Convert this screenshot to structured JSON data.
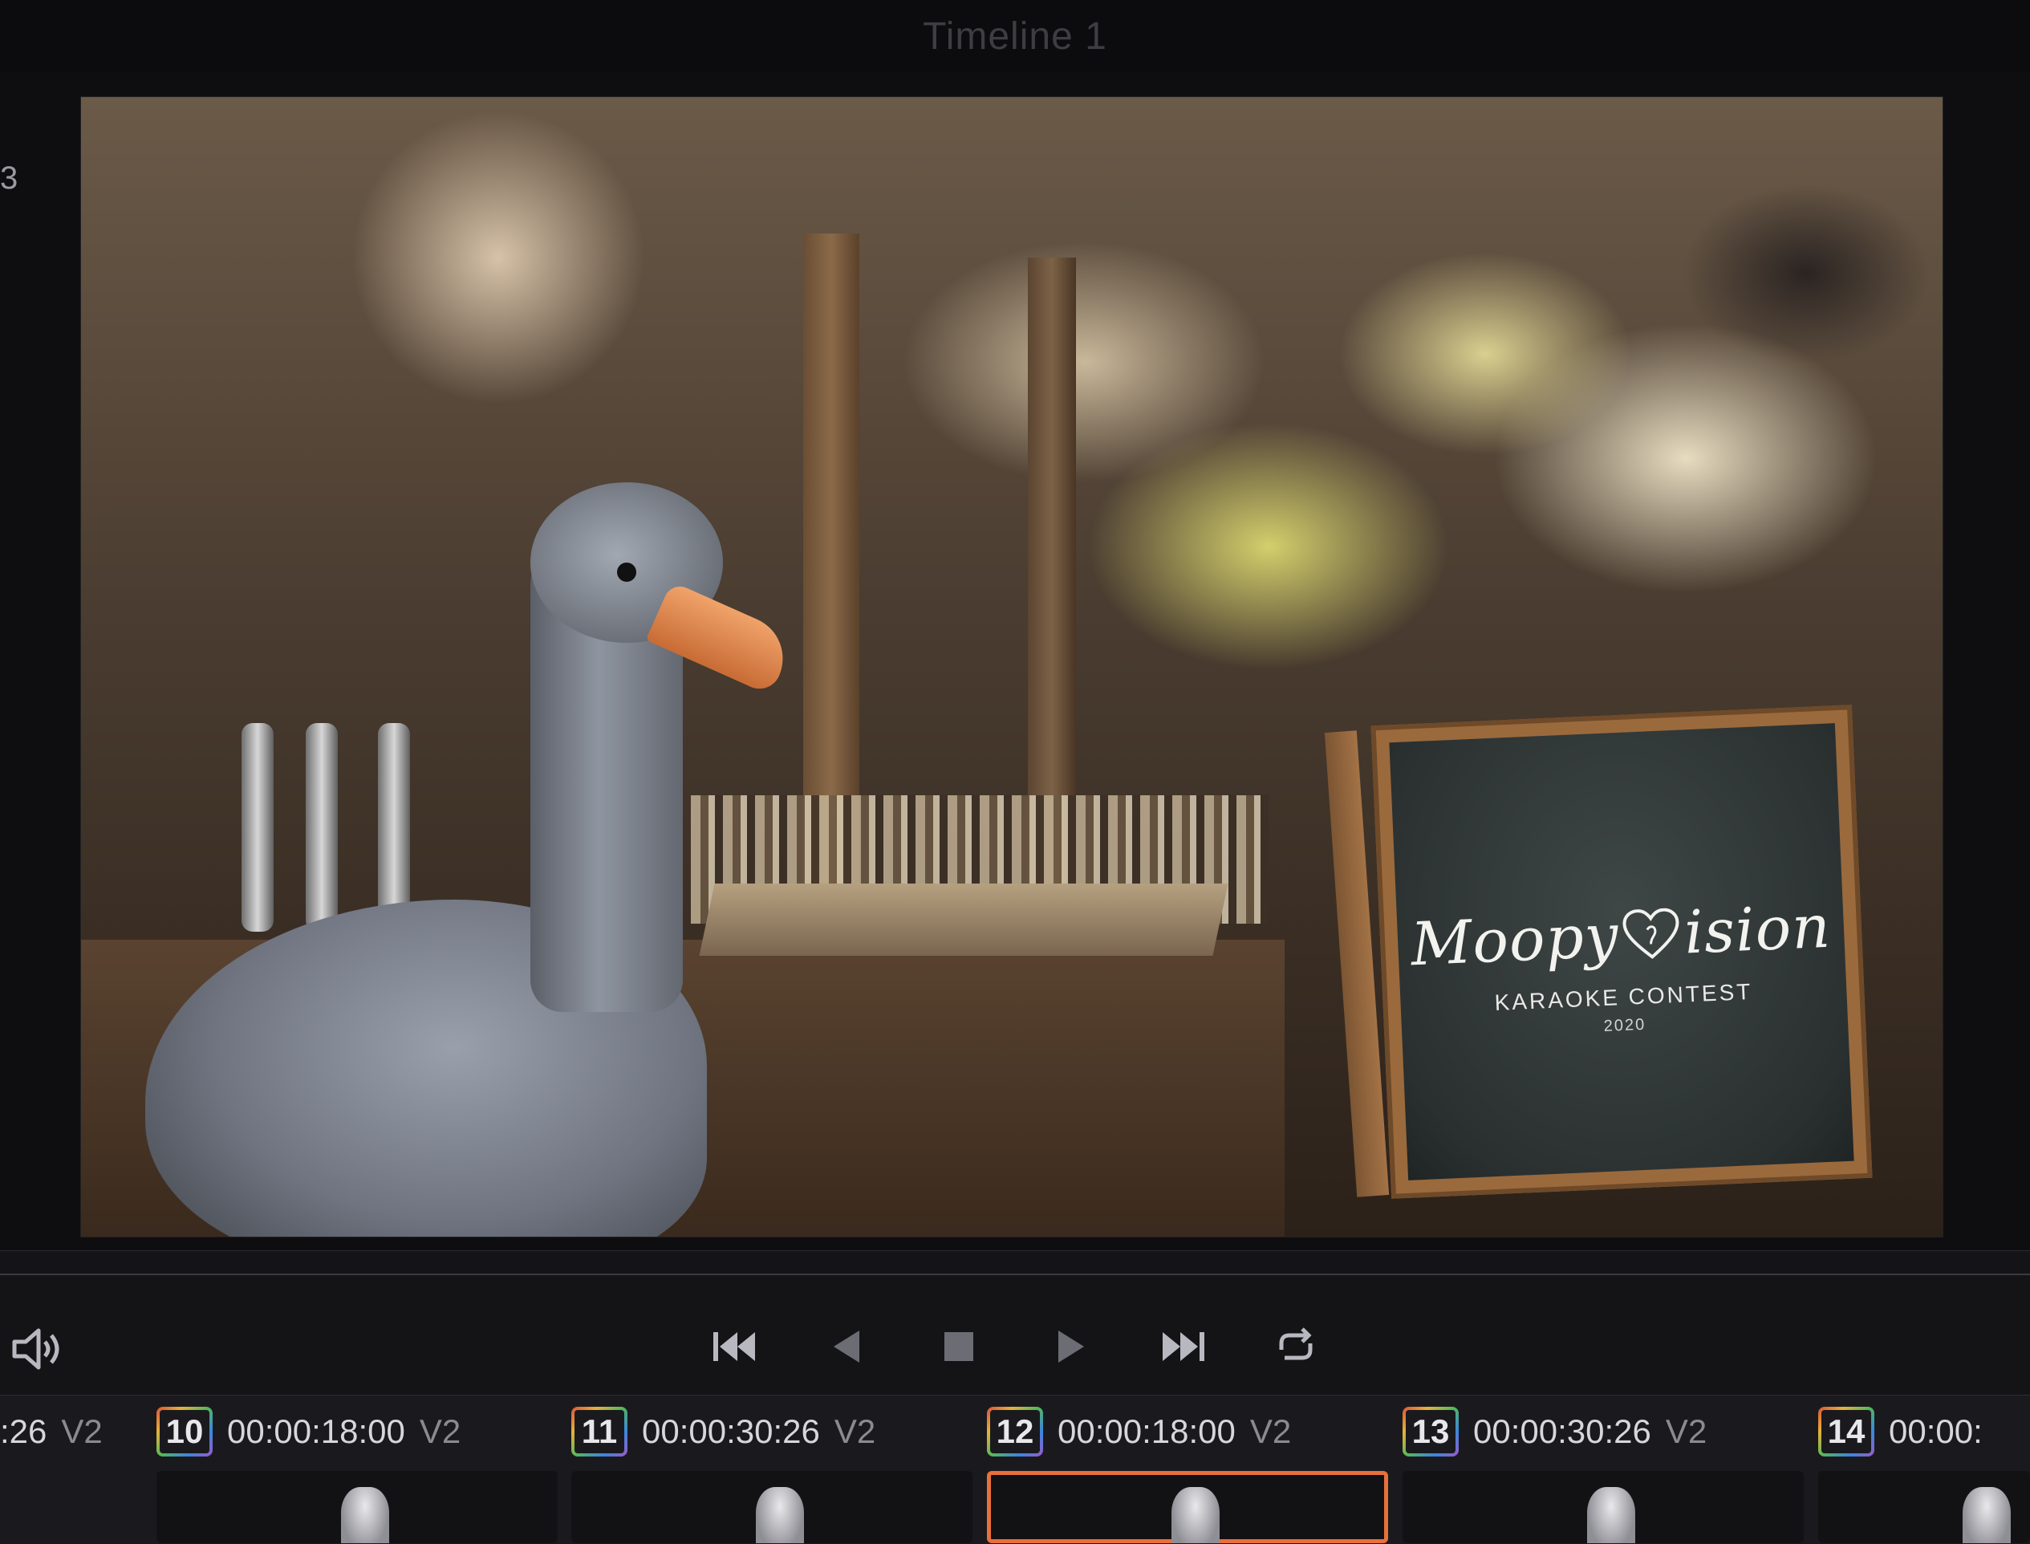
{
  "window": {
    "title": "Timeline 1",
    "left_marker": "3"
  },
  "viewer": {
    "board": {
      "logo_prefix": "Moopy",
      "logo_suffix": "ision",
      "subtitle": "KARAOKE CONTEST",
      "year": "2020"
    }
  },
  "transport": {
    "volume_icon": "speaker-icon",
    "controls": [
      {
        "name": "skip-to-start-button",
        "icon": "skip-start-icon"
      },
      {
        "name": "play-reverse-button",
        "icon": "play-reverse-icon"
      },
      {
        "name": "stop-button",
        "icon": "stop-icon"
      },
      {
        "name": "play-button",
        "icon": "play-icon"
      },
      {
        "name": "skip-to-end-button",
        "icon": "skip-end-icon"
      },
      {
        "name": "loop-button",
        "icon": "loop-icon"
      }
    ]
  },
  "clips": {
    "partial": {
      "timecode": ":26",
      "track": "V2"
    },
    "items": [
      {
        "number": "10",
        "timecode": "00:00:18:00",
        "track": "V2"
      },
      {
        "number": "11",
        "timecode": "00:00:30:26",
        "track": "V2"
      },
      {
        "number": "12",
        "timecode": "00:00:18:00",
        "track": "V2"
      },
      {
        "number": "13",
        "timecode": "00:00:30:26",
        "track": "V2"
      },
      {
        "number": "14",
        "timecode": "00:00:"
      }
    ]
  },
  "colors": {
    "selected_clip_outline": "#e8703a",
    "clip_badge_gradient": [
      "#d9503a",
      "#e6b23a",
      "#53b85a",
      "#3c86e0",
      "#9b59c6"
    ]
  }
}
